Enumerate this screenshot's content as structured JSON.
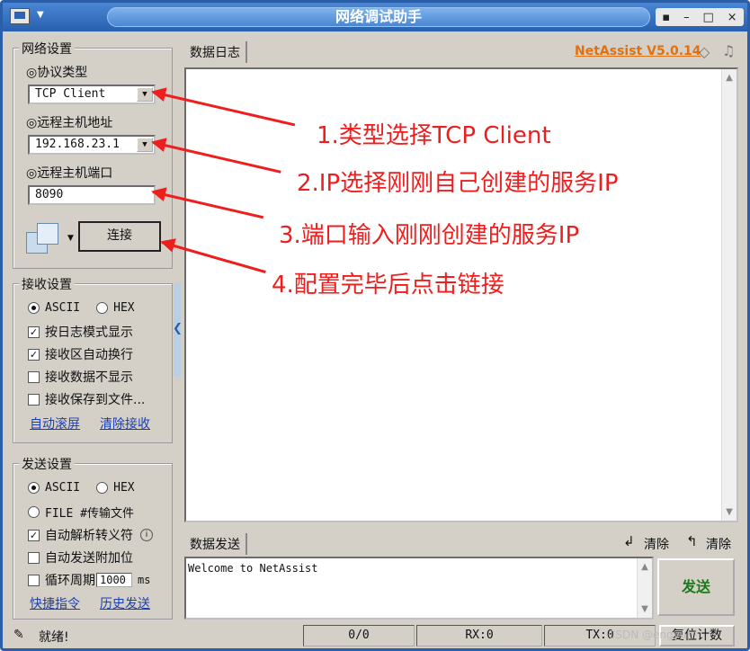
{
  "window": {
    "title": "网络调试助手",
    "version_label": "NetAssist V5.0.14",
    "controls": [
      "▪",
      "–",
      "□",
      "×"
    ]
  },
  "network": {
    "group_title": "网络设置",
    "protocol_label": "◎协议类型",
    "protocol_value": "TCP Client",
    "host_label": "◎远程主机地址",
    "host_value": "192.168.23.1",
    "port_label": "◎远程主机端口",
    "port_value": "8090",
    "connect_label": "连接"
  },
  "receive": {
    "group_title": "接收设置",
    "ascii": "ASCII",
    "hex": "HEX",
    "options": [
      {
        "label": "按日志模式显示",
        "checked": true
      },
      {
        "label": "接收区自动换行",
        "checked": true
      },
      {
        "label": "接收数据不显示",
        "checked": false
      },
      {
        "label": "接收保存到文件...",
        "checked": false
      }
    ],
    "auto_scroll": "自动滚屏",
    "clear_recv": "清除接收"
  },
  "send": {
    "group_title": "发送设置",
    "ascii": "ASCII",
    "hex": "HEX",
    "file": "FILE #传输文件",
    "options": [
      {
        "label": "自动解析转义符",
        "checked": true
      },
      {
        "label": "自动发送附加位",
        "checked": false
      }
    ],
    "loop_label": "循环周期",
    "loop_value": "1000",
    "loop_unit": "ms",
    "shortcut": "快捷指令",
    "history": "历史发送"
  },
  "log": {
    "tab_label": "数据日志"
  },
  "send_area": {
    "tab_label": "数据发送",
    "clear1": "清除",
    "clear2": "清除",
    "content": "Welcome to NetAssist",
    "send_button": "发送"
  },
  "status": {
    "ready": "就绪!",
    "count": "0/0",
    "rx": "RX:0",
    "tx": "TX:0",
    "reset": "复位计数"
  },
  "annotations": [
    "1.类型选择TCP Client",
    "2.IP选择刚刚自己创建的服务IP",
    "3.端口输入刚刚创建的服务IP",
    "4.配置完毕后点击链接"
  ],
  "watermark": "CSDN @engyun"
}
